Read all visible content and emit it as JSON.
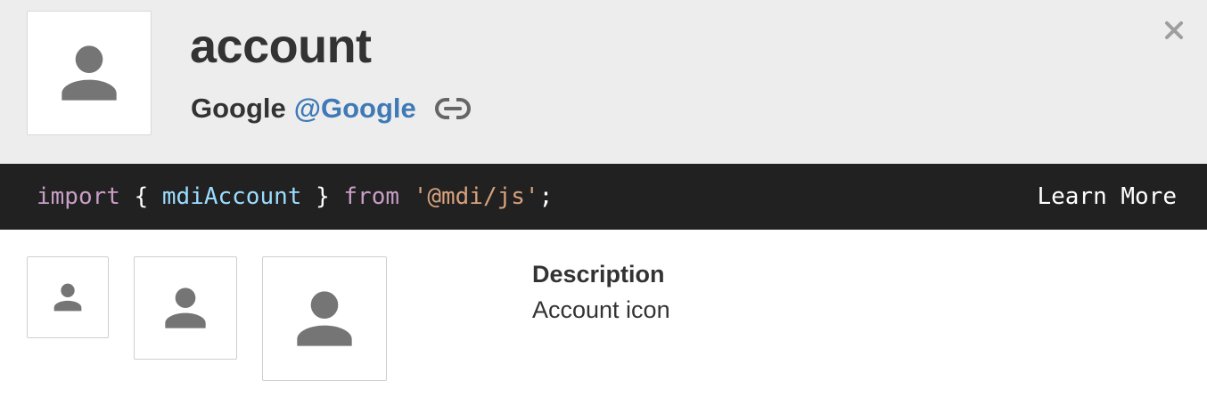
{
  "icon": {
    "name": "account",
    "author": "Google",
    "author_handle": "@Google",
    "preview_icon": "account-icon"
  },
  "header": {
    "link_icon": "link-icon",
    "close_icon": "close-icon"
  },
  "code": {
    "import_kw": "import",
    "open_brace": " { ",
    "identifier": "mdiAccount",
    "close_brace": " } ",
    "from_kw": "from",
    "space": " ",
    "module": "'@mdi/js'",
    "semicolon": ";",
    "learn_more": "Learn More"
  },
  "sizes": [
    {
      "icon": "account-icon"
    },
    {
      "icon": "account-icon"
    },
    {
      "icon": "account-icon"
    }
  ],
  "description": {
    "heading": "Description",
    "text": "Account icon"
  },
  "colors": {
    "header_bg": "#ededed",
    "code_bg": "#212121",
    "handle": "#3f7ab6",
    "icon_fill": "#757575"
  }
}
